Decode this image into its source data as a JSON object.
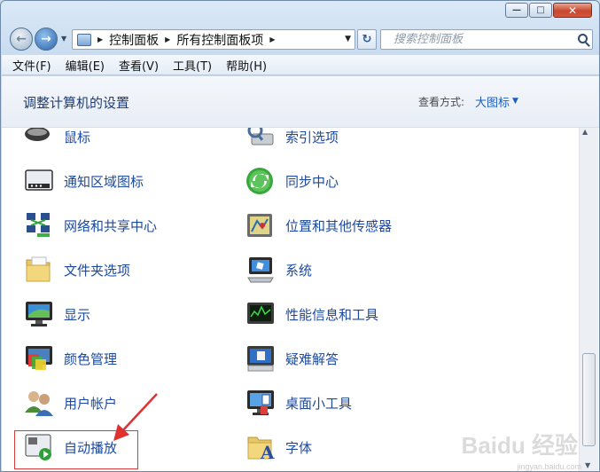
{
  "window": {
    "caption_buttons": {
      "minimize": "—",
      "maximize": "□",
      "close": "✕"
    }
  },
  "address_bar": {
    "crumbs": [
      "控制面板",
      "所有控制面板项"
    ],
    "search_placeholder": "搜索控制面板"
  },
  "menu": [
    "文件(F)",
    "编辑(E)",
    "查看(V)",
    "工具(T)",
    "帮助(H)"
  ],
  "header": {
    "title": "调整计算机的设置",
    "view_label": "查看方式:",
    "view_value": "大图标"
  },
  "items_left": [
    {
      "label": "鼠标",
      "icon": "mouse-icon"
    },
    {
      "label": "通知区域图标",
      "icon": "notification-area-icon"
    },
    {
      "label": "网络和共享中心",
      "icon": "network-icon"
    },
    {
      "label": "文件夹选项",
      "icon": "folder-options-icon"
    },
    {
      "label": "显示",
      "icon": "display-icon"
    },
    {
      "label": "颜色管理",
      "icon": "color-management-icon"
    },
    {
      "label": "用户帐户",
      "icon": "user-accounts-icon"
    },
    {
      "label": "自动播放",
      "icon": "autoplay-icon"
    }
  ],
  "items_right": [
    {
      "label": "索引选项",
      "icon": "indexing-icon"
    },
    {
      "label": "同步中心",
      "icon": "sync-center-icon"
    },
    {
      "label": "位置和其他传感器",
      "icon": "location-sensor-icon"
    },
    {
      "label": "系统",
      "icon": "system-icon"
    },
    {
      "label": "性能信息和工具",
      "icon": "performance-icon"
    },
    {
      "label": "疑难解答",
      "icon": "troubleshooting-icon"
    },
    {
      "label": "桌面小工具",
      "icon": "desktop-gadgets-icon"
    },
    {
      "label": "字体",
      "icon": "fonts-icon"
    }
  ],
  "watermark": {
    "text": "Baidu 经验",
    "sub": "jingyan.baidu.com"
  },
  "colors": {
    "link": "#1c4aa0",
    "title": "#1c3d7a",
    "highlight": "#d83a3a"
  }
}
